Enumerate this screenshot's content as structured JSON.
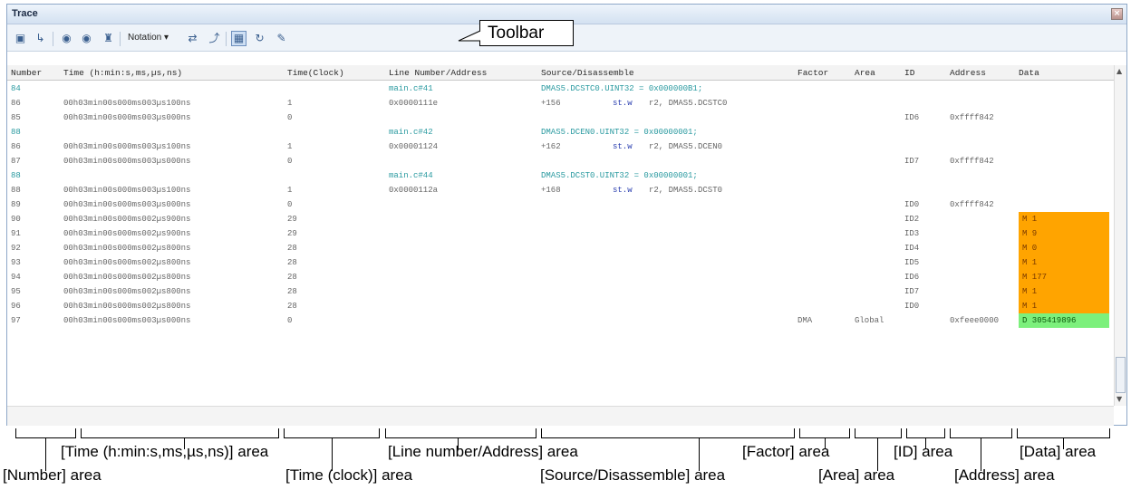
{
  "window": {
    "title": "Trace",
    "close": "×"
  },
  "toolbar": {
    "notation_label": "Notation ▾",
    "callout": "Toolbar",
    "icons": [
      "trace-settings-icon",
      "step-icon",
      "find-icon",
      "find-next-icon",
      "binoculars-icon",
      "mix-icon",
      "jump-source-icon",
      "select-icon",
      "refresh-icon",
      "save-icon"
    ]
  },
  "columns": [
    "Number",
    "Time (h:min:s,ms,µs,ns)",
    "Time(Clock)",
    "Line Number/Address",
    "Source/Disassemble",
    "Factor",
    "Area",
    "ID",
    "Address",
    "Data"
  ],
  "rows": [
    {
      "number": "84",
      "time": "",
      "clock": "",
      "line": "main.c#41",
      "source": "DMAS5.DCSTC0.UINT32 = 0x000000B1;",
      "op": "",
      "args": "",
      "factor": "",
      "area": "",
      "id": "",
      "address": "",
      "data": "",
      "style": "src"
    },
    {
      "number": "86",
      "time": "00h03min00s000ms003µs100ns",
      "clock": "1",
      "line": "0x0000111e",
      "source": "+156",
      "op": "st.w",
      "args": "r2, DMAS5.DCSTC0",
      "factor": "",
      "area": "",
      "id": "",
      "address": "",
      "data": "",
      "style": "asm"
    },
    {
      "number": "85",
      "time": "00h03min00s000ms003µs000ns",
      "clock": "0",
      "line": "",
      "source": "",
      "op": "",
      "args": "",
      "factor": "",
      "area": "",
      "id": "ID6",
      "address": "0xffff842",
      "data": "",
      "style": "plain"
    },
    {
      "number": "88",
      "time": "",
      "clock": "",
      "line": "main.c#42",
      "source": "DMAS5.DCEN0.UINT32 = 0x00000001;",
      "op": "",
      "args": "",
      "factor": "",
      "area": "",
      "id": "",
      "address": "",
      "data": "",
      "style": "src"
    },
    {
      "number": "86",
      "time": "00h03min00s000ms003µs100ns",
      "clock": "1",
      "line": "0x00001124",
      "source": "+162",
      "op": "st.w",
      "args": "r2, DMAS5.DCEN0",
      "factor": "",
      "area": "",
      "id": "",
      "address": "",
      "data": "",
      "style": "asm"
    },
    {
      "number": "87",
      "time": "00h03min00s000ms003µs000ns",
      "clock": "0",
      "line": "",
      "source": "",
      "op": "",
      "args": "",
      "factor": "",
      "area": "",
      "id": "ID7",
      "address": "0xffff842",
      "data": "",
      "style": "plain"
    },
    {
      "number": "88",
      "time": "",
      "clock": "",
      "line": "main.c#44",
      "source": "DMAS5.DCST0.UINT32 = 0x00000001;",
      "op": "",
      "args": "",
      "factor": "",
      "area": "",
      "id": "",
      "address": "",
      "data": "",
      "style": "src"
    },
    {
      "number": "88",
      "time": "00h03min00s000ms003µs100ns",
      "clock": "1",
      "line": "0x0000112a",
      "source": "+168",
      "op": "st.w",
      "args": "r2, DMAS5.DCST0",
      "factor": "",
      "area": "",
      "id": "",
      "address": "",
      "data": "",
      "style": "asm"
    },
    {
      "number": "89",
      "time": "00h03min00s000ms003µs000ns",
      "clock": "0",
      "line": "",
      "source": "",
      "op": "",
      "args": "",
      "factor": "",
      "area": "",
      "id": "ID0",
      "address": "0xffff842",
      "data": "",
      "style": "plain"
    },
    {
      "number": "90",
      "time": "00h03min00s000ms002µs900ns",
      "clock": "29",
      "line": "",
      "source": "",
      "op": "",
      "args": "",
      "factor": "",
      "area": "",
      "id": "ID2",
      "address": "",
      "data": "M 1",
      "style": "orange"
    },
    {
      "number": "91",
      "time": "00h03min00s000ms002µs900ns",
      "clock": "29",
      "line": "",
      "source": "",
      "op": "",
      "args": "",
      "factor": "",
      "area": "",
      "id": "ID3",
      "address": "",
      "data": "M 9",
      "style": "orange"
    },
    {
      "number": "92",
      "time": "00h03min00s000ms002µs800ns",
      "clock": "28",
      "line": "",
      "source": "",
      "op": "",
      "args": "",
      "factor": "",
      "area": "",
      "id": "ID4",
      "address": "",
      "data": "M 0",
      "style": "orange"
    },
    {
      "number": "93",
      "time": "00h03min00s000ms002µs800ns",
      "clock": "28",
      "line": "",
      "source": "",
      "op": "",
      "args": "",
      "factor": "",
      "area": "",
      "id": "ID5",
      "address": "",
      "data": "M 1",
      "style": "orange"
    },
    {
      "number": "94",
      "time": "00h03min00s000ms002µs800ns",
      "clock": "28",
      "line": "",
      "source": "",
      "op": "",
      "args": "",
      "factor": "",
      "area": "",
      "id": "ID6",
      "address": "",
      "data": "M 177",
      "style": "orange"
    },
    {
      "number": "95",
      "time": "00h03min00s000ms002µs800ns",
      "clock": "28",
      "line": "",
      "source": "",
      "op": "",
      "args": "",
      "factor": "",
      "area": "",
      "id": "ID7",
      "address": "",
      "data": "M 1",
      "style": "orange"
    },
    {
      "number": "96",
      "time": "00h03min00s000ms002µs800ns",
      "clock": "28",
      "line": "",
      "source": "",
      "op": "",
      "args": "",
      "factor": "",
      "area": "",
      "id": "ID0",
      "address": "",
      "data": "M 1",
      "style": "orange"
    },
    {
      "number": "97",
      "time": "00h03min00s000ms003µs000ns",
      "clock": "0",
      "line": "",
      "source": "",
      "op": "",
      "args": "",
      "factor": "DMA",
      "area": "Global",
      "id": "",
      "address": "0xfeee0000",
      "data": "D 305419896",
      "style": "green"
    }
  ],
  "annotations": {
    "time_area": "[Time (h:min:s,ms,µs,ns)] area",
    "line_area": "[Line number/Address] area",
    "factor_area": "[Factor] area",
    "id_area": "[ID] area",
    "data_area": "[Data] area",
    "number_area": "[Number] area",
    "clock_area": "[Time (clock)] area",
    "source_area": "[Source/Disassemble] area",
    "area_area": "[Area] area",
    "address_area": "[Address] area"
  },
  "colors": {
    "data_highlight": "#ffa400",
    "data_dma": "#7cf07c",
    "source_line": "#2a9aa0",
    "instruction": "#2b3fb0"
  }
}
